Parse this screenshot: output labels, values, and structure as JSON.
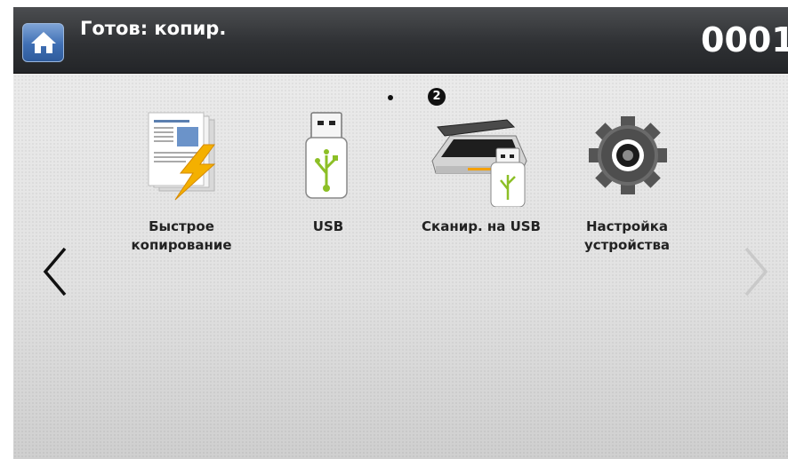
{
  "header": {
    "status_title": "Готов: копир.",
    "counter": "0001"
  },
  "pager": {
    "current_page": "2"
  },
  "apps": [
    {
      "label_line1": "Быстрое",
      "label_line2": "копирование",
      "icon": "quick-copy-icon"
    },
    {
      "label_line1": "USB",
      "label_line2": "",
      "icon": "usb-drive-icon"
    },
    {
      "label_line1": "Сканир. на USB",
      "label_line2": "",
      "icon": "scan-to-usb-icon"
    },
    {
      "label_line1": "Настройка",
      "label_line2": "устройства",
      "icon": "gear-icon"
    }
  ],
  "colors": {
    "header_bg": "#2f3134",
    "home_button": "#3f6fb4",
    "usb_symbol": "#8cbf26",
    "lightning": "#f4b000"
  }
}
